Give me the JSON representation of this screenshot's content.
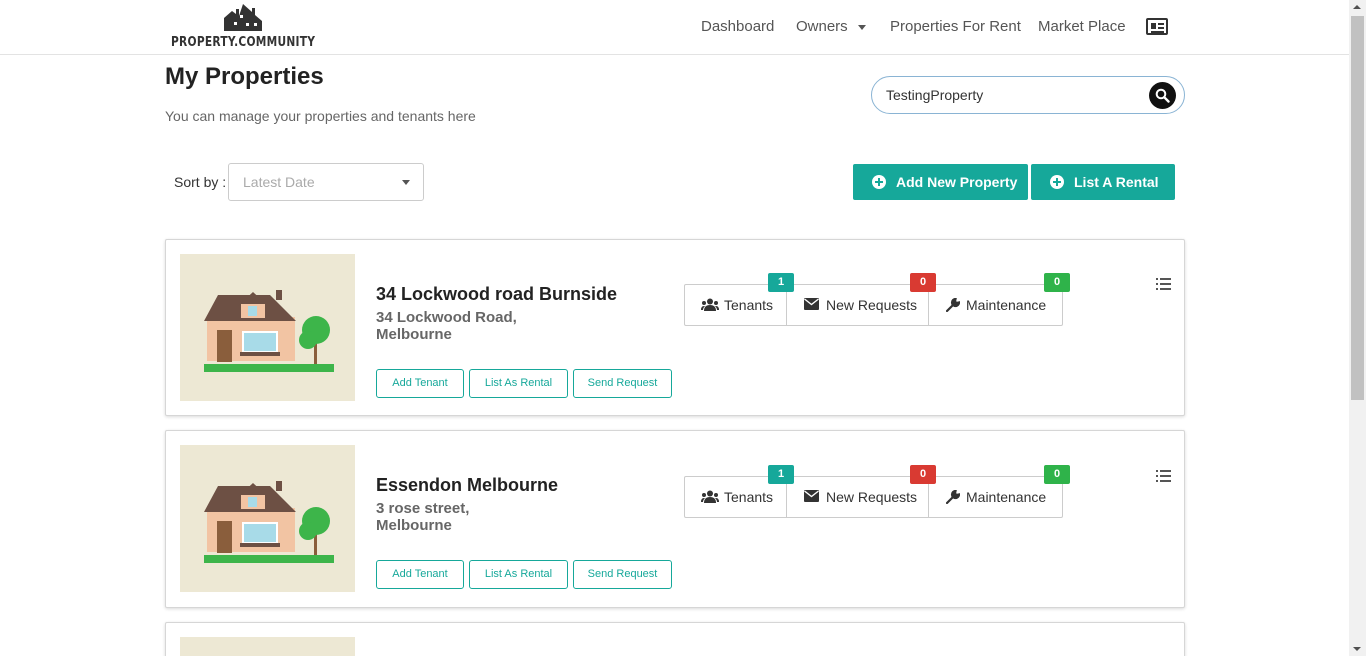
{
  "header": {
    "logo_text": "PROPERTY.COMMUNITY",
    "nav": {
      "dashboard": "Dashboard",
      "owners": "Owners",
      "properties_for_rent": "Properties For Rent",
      "market_place": "Market Place"
    }
  },
  "page": {
    "title": "My Properties",
    "subtitle": "You can manage your properties and tenants here"
  },
  "search": {
    "value": "TestingProperty"
  },
  "sort": {
    "label": "Sort by :",
    "selected": "Latest Date"
  },
  "actions": {
    "add_property": "Add New Property",
    "list_rental": "List A Rental"
  },
  "properties": [
    {
      "name": "34 Lockwood road Burnside",
      "address_line1": "34 Lockwood Road,",
      "address_line2": "Melbourne",
      "buttons": {
        "add_tenant": "Add Tenant",
        "list_rental": "List As Rental",
        "send_request": "Send Request"
      },
      "stats": {
        "tenants_label": "Tenants",
        "tenants_count": "1",
        "requests_label": "New Requests",
        "requests_count": "0",
        "maintenance_label": "Maintenance",
        "maintenance_count": "0"
      }
    },
    {
      "name": "Essendon Melbourne",
      "address_line1": "3 rose street,",
      "address_line2": "Melbourne",
      "buttons": {
        "add_tenant": "Add Tenant",
        "list_rental": "List As Rental",
        "send_request": "Send Request"
      },
      "stats": {
        "tenants_label": "Tenants",
        "tenants_count": "1",
        "requests_label": "New Requests",
        "requests_count": "0",
        "maintenance_label": "Maintenance",
        "maintenance_count": "0"
      }
    }
  ],
  "colors": {
    "accent": "#16a89a",
    "badge_red": "#d93a32",
    "badge_green": "#2fb34a",
    "thumb_bg": "#ede8d4"
  },
  "icons": [
    "house-logo-icon",
    "caret-down-icon",
    "id-card-icon",
    "search-icon",
    "plus-circle-icon",
    "users-icon",
    "envelope-icon",
    "wrench-icon",
    "list-icon",
    "house-illustration"
  ]
}
